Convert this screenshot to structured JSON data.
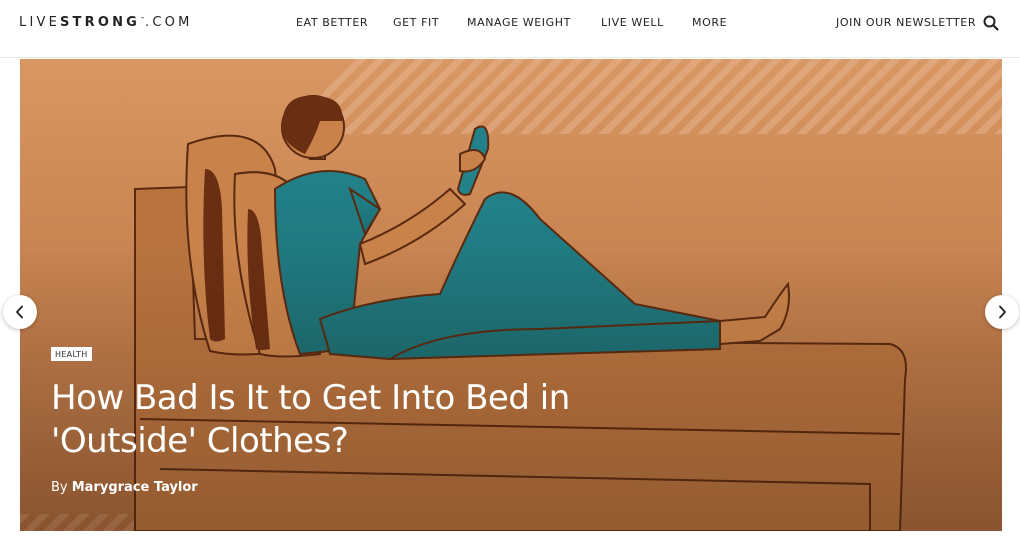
{
  "logo": {
    "part1": "LIVE",
    "part2": "STRONG",
    "tm": "™",
    "part3": ".COM"
  },
  "nav": {
    "items": [
      {
        "label": "EAT BETTER"
      },
      {
        "label": "GET FIT"
      },
      {
        "label": "MANAGE WEIGHT"
      },
      {
        "label": "LIVE WELL"
      },
      {
        "label": "MORE"
      }
    ],
    "newsletter_label": "JOIN OUR NEWSLETTER",
    "search_icon": "search-icon"
  },
  "hero": {
    "category": "HEALTH",
    "headline": "How Bad Is It to Get Into Bed in 'Outside' Clothes?",
    "byline_prefix": "By ",
    "author": "Marygrace Taylor",
    "prev_icon": "chevron-left-icon",
    "next_icon": "chevron-right-icon"
  },
  "colors": {
    "hero_bg": "#c88451",
    "outfit": "#1f7a80",
    "outline": "#5a2a10",
    "text": "#ffffff"
  }
}
